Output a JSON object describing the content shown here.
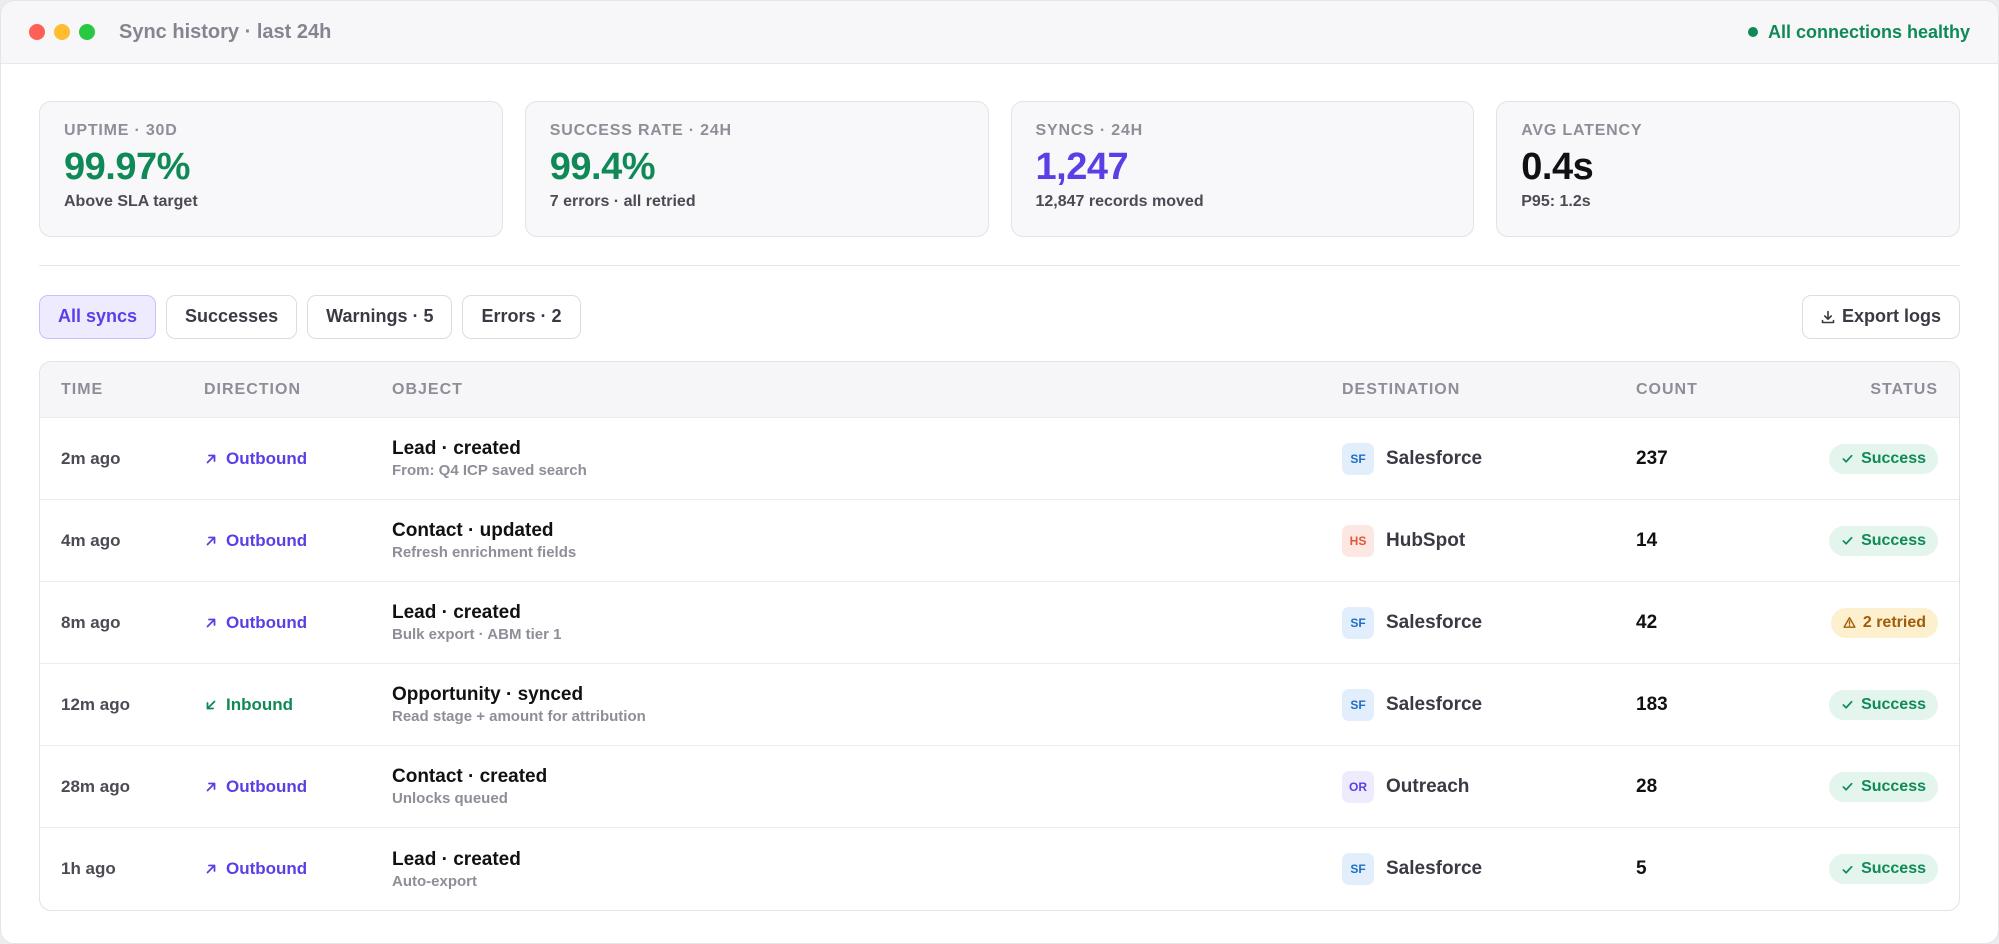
{
  "window": {
    "title": "Sync history · last 24h",
    "health": "All connections healthy"
  },
  "colors": {
    "accent": "#5b3fe6",
    "success": "#0f8a57",
    "warning": "#a15c07"
  },
  "stats": [
    {
      "label": "UPTIME · 30D",
      "value": "99.97%",
      "sub": "Above SLA target",
      "color": "#0f8a57"
    },
    {
      "label": "SUCCESS RATE · 24H",
      "value": "99.4%",
      "sub": "7 errors · all retried",
      "color": "#0f8a57"
    },
    {
      "label": "SYNCS · 24H",
      "value": "1,247",
      "sub": "12,847 records moved",
      "color": "#5b3fe6"
    },
    {
      "label": "AVG LATENCY",
      "value": "0.4s",
      "sub": "P95: 1.2s",
      "color": "#111114"
    }
  ],
  "filters": [
    {
      "label": "All syncs",
      "active": true
    },
    {
      "label": "Successes",
      "active": false
    },
    {
      "label": "Warnings · 5",
      "active": false
    },
    {
      "label": "Errors · 2",
      "active": false
    }
  ],
  "export_label": "Export logs",
  "table": {
    "headers": {
      "time": "TIME",
      "direction": "DIRECTION",
      "object": "OBJECT",
      "destination": "DESTINATION",
      "count": "COUNT",
      "status": "STATUS"
    },
    "rows": [
      {
        "time": "2m ago",
        "direction": "Outbound",
        "dir_type": "outbound",
        "object": "Lead · created",
        "object_sub": "From: Q4 ICP saved search",
        "dest_code": "SF",
        "dest_name": "Salesforce",
        "dest_kind": "sf",
        "count": "237",
        "status": "Success",
        "status_type": "success"
      },
      {
        "time": "4m ago",
        "direction": "Outbound",
        "dir_type": "outbound",
        "object": "Contact · updated",
        "object_sub": "Refresh enrichment fields",
        "dest_code": "HS",
        "dest_name": "HubSpot",
        "dest_kind": "hs",
        "count": "14",
        "status": "Success",
        "status_type": "success"
      },
      {
        "time": "8m ago",
        "direction": "Outbound",
        "dir_type": "outbound",
        "object": "Lead · created",
        "object_sub": "Bulk export · ABM tier 1",
        "dest_code": "SF",
        "dest_name": "Salesforce",
        "dest_kind": "sf",
        "count": "42",
        "status": "2 retried",
        "status_type": "warning"
      },
      {
        "time": "12m ago",
        "direction": "Inbound",
        "dir_type": "inbound",
        "object": "Opportunity · synced",
        "object_sub": "Read stage + amount for attribution",
        "dest_code": "SF",
        "dest_name": "Salesforce",
        "dest_kind": "sf",
        "count": "183",
        "status": "Success",
        "status_type": "success"
      },
      {
        "time": "28m ago",
        "direction": "Outbound",
        "dir_type": "outbound",
        "object": "Contact · created",
        "object_sub": "Unlocks queued",
        "dest_code": "OR",
        "dest_name": "Outreach",
        "dest_kind": "or",
        "count": "28",
        "status": "Success",
        "status_type": "success"
      },
      {
        "time": "1h ago",
        "direction": "Outbound",
        "dir_type": "outbound",
        "object": "Lead · created",
        "object_sub": "Auto-export",
        "dest_code": "SF",
        "dest_name": "Salesforce",
        "dest_kind": "sf",
        "count": "5",
        "status": "Success",
        "status_type": "success"
      }
    ]
  }
}
